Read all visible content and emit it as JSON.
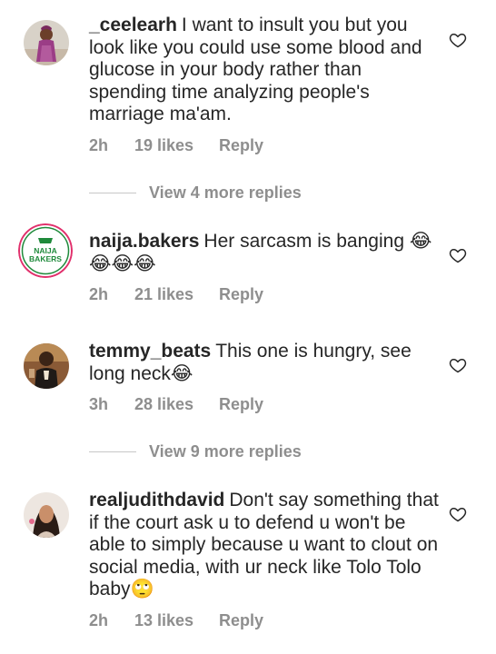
{
  "comments": [
    {
      "username": "_ceelearh",
      "text": "I want to insult you but you look like you could use some blood and glucose in your body rather than spending time analyzing people's marriage ma'am.",
      "time": "2h",
      "likes": "19 likes",
      "reply_label": "Reply",
      "view_more": "View 4 more replies"
    },
    {
      "username": "naija.bakers",
      "text": "Her sarcasm is banging 😂😂😂😂",
      "time": "2h",
      "likes": "21 likes",
      "reply_label": "Reply",
      "avatar_text": {
        "line1": "NAIJA",
        "line2": "BAKERS"
      }
    },
    {
      "username": "temmy_beats",
      "text": "This one is hungry, see long neck😂",
      "time": "3h",
      "likes": "28 likes",
      "reply_label": "Reply",
      "view_more": "View 9 more replies"
    },
    {
      "username": "realjudithdavid",
      "text": "Don't say something that if the court ask u to defend u won't be able to simply because u want to clout on social media, with ur neck like Tolo Tolo baby🙄",
      "time": "2h",
      "likes": "13 likes",
      "reply_label": "Reply"
    }
  ],
  "icons": {
    "like": "heart-outline-icon"
  },
  "colors": {
    "text": "#262626",
    "meta": "#8e8e8e",
    "divider": "#c7c7c7",
    "bakers_green": "#1f8a3b",
    "story_ring": "#e1306c"
  }
}
